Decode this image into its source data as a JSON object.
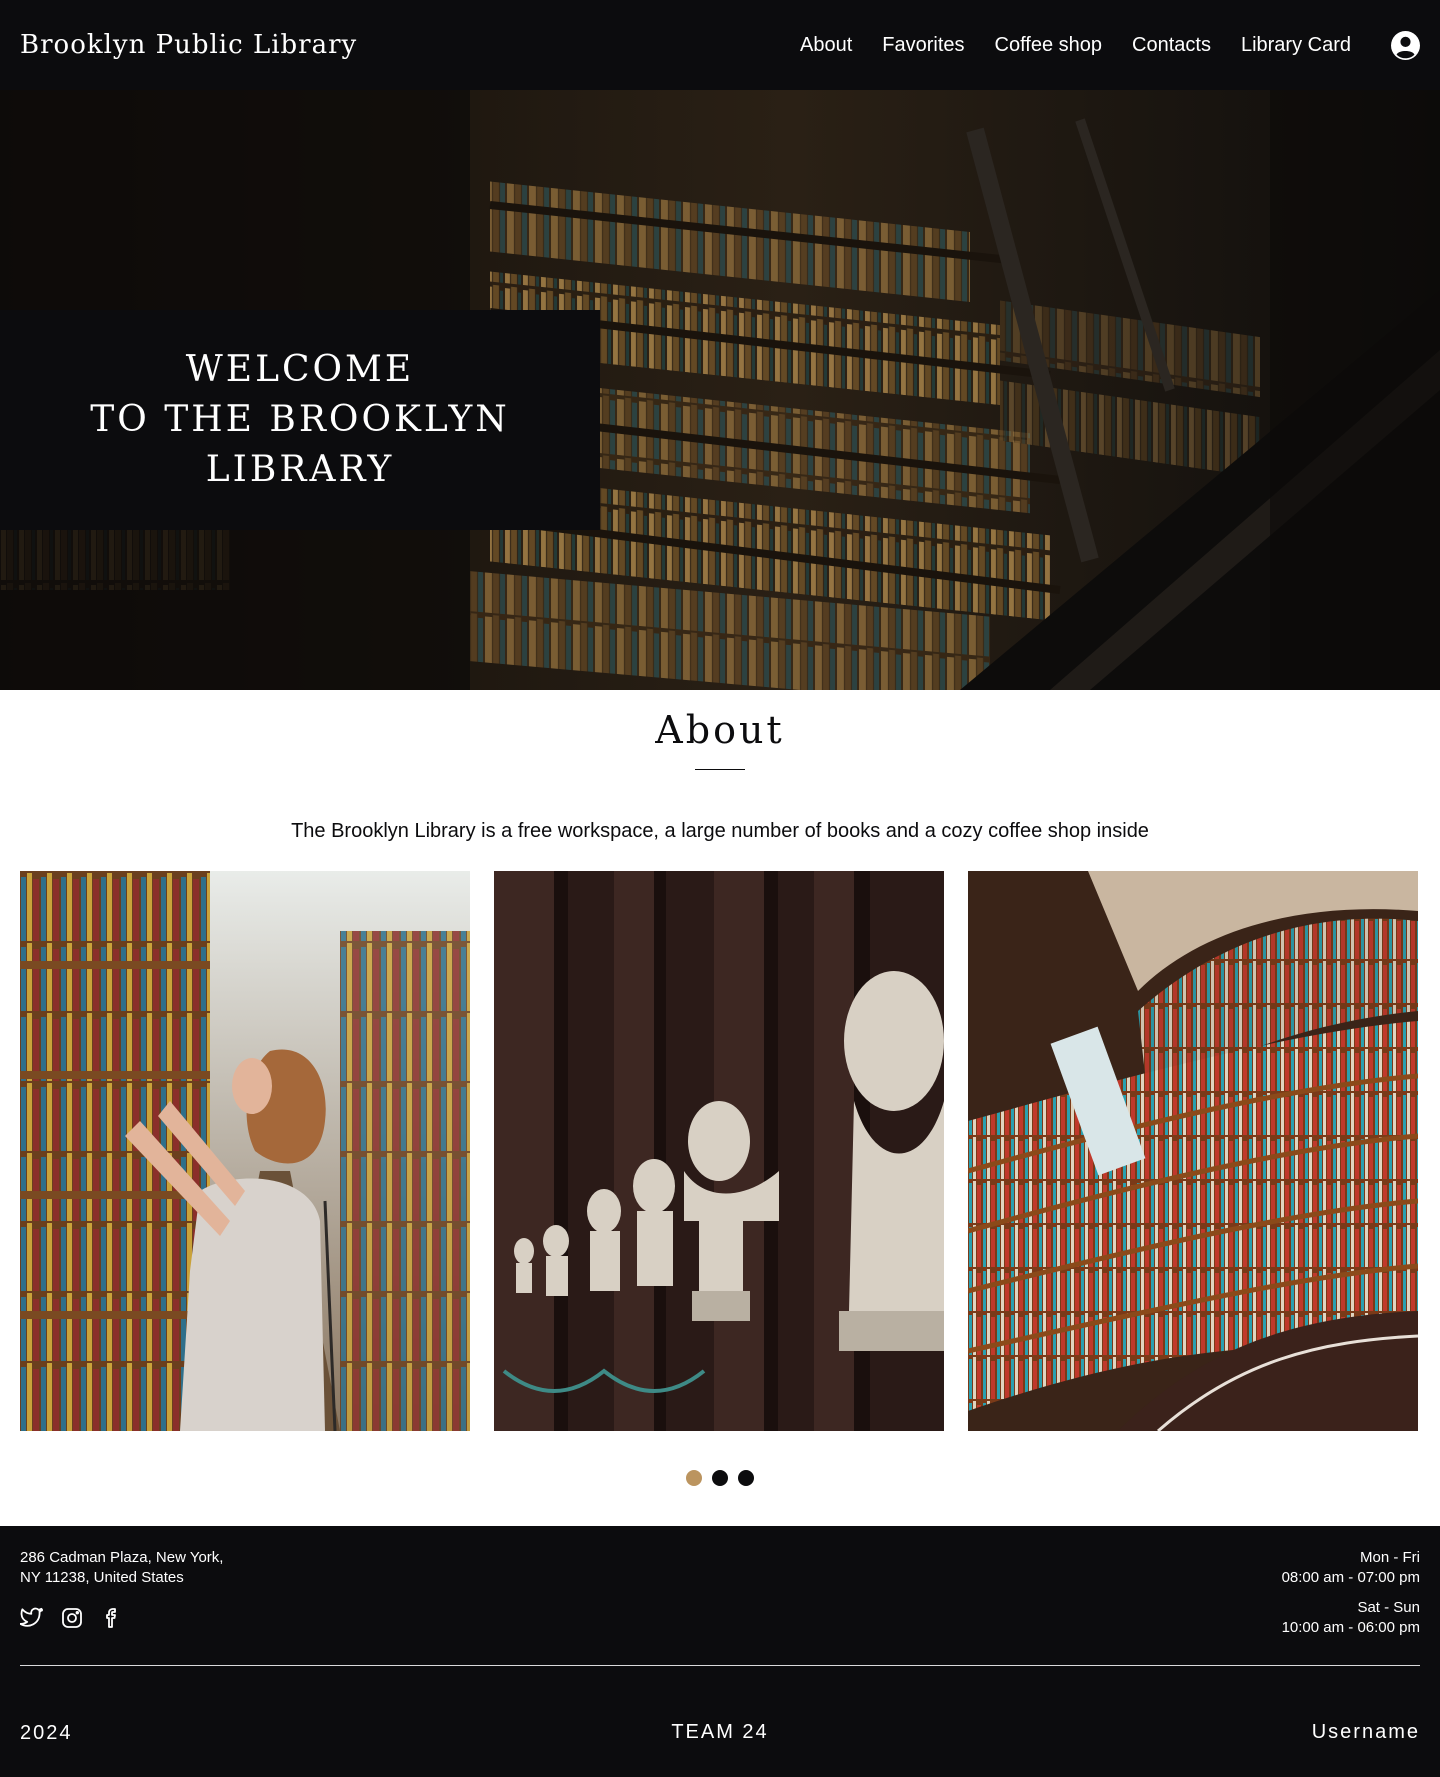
{
  "header": {
    "brand": "Brooklyn Public Library",
    "nav": [
      "About",
      "Favorites",
      "Coffee shop",
      "Contacts",
      "Library Card"
    ],
    "profile_icon": "user-circle-icon"
  },
  "hero": {
    "welcome": "WELCOME\nTO THE BROOKLYN\nLIBRARY"
  },
  "about": {
    "title": "About",
    "description": "The Brooklyn Library is a free workspace, a large number of books and a cozy coffee shop inside",
    "photos": [
      "woman-browsing-bookshelf",
      "marble-busts-hall",
      "curved-library-shelves"
    ],
    "slider": {
      "count": 3,
      "active": 1,
      "active_color": "#bb945f"
    }
  },
  "footer": {
    "address_line1": "286 Cadman Plaza, New York,",
    "address_line2": "NY 11238, United States",
    "socials": [
      "twitter-icon",
      "instagram-icon",
      "facebook-icon"
    ],
    "weekday_label": "Mon - Fri",
    "weekday_hours": "08:00 am - 07:00 pm",
    "weekend_label": "Sat - Sun",
    "weekend_hours": "10:00 am - 06:00 pm",
    "year": "2024",
    "team": "TEAM 24",
    "username": "Username"
  },
  "colors": {
    "background": "#0c0c0e",
    "accent": "#bb945f",
    "text_light": "#ffffff"
  }
}
